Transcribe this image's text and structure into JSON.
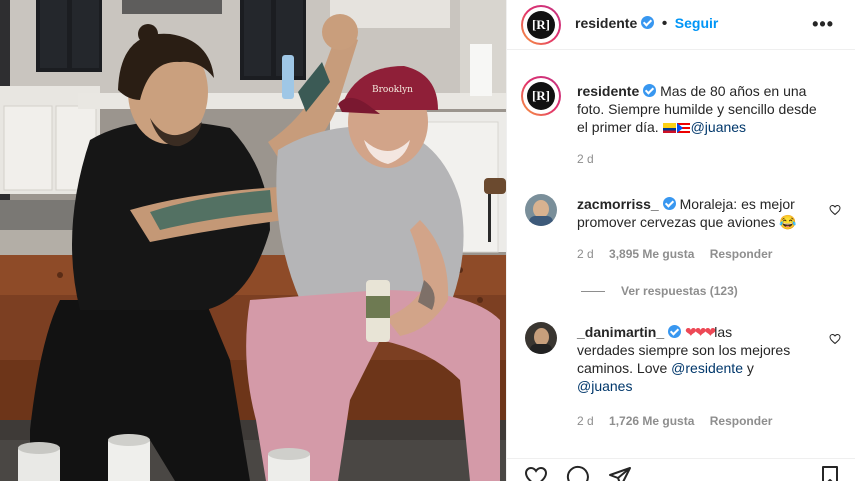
{
  "post": {
    "author": "residente",
    "follow_label": "Seguir",
    "more_label": "•••",
    "caption": {
      "username": "residente",
      "line1": "Mas de 80 años en una",
      "line2": "foto. Siempre humilde y sencillo desde",
      "line3": "el primer día.",
      "mention": "@juanes",
      "flags": [
        "colombia-flag-icon",
        "puerto-rico-flag-icon"
      ]
    },
    "caption_time": "2 d",
    "photo": {
      "cap_text": "Brooklyn"
    }
  },
  "comments": [
    {
      "username": "zacmorriss_",
      "line1": "Moraleja: es mejor",
      "line2": "promover cervezas que aviones",
      "emoji": "😂",
      "time": "2 d",
      "likes": "3,895 Me gusta",
      "reply_label": "Responder",
      "view_replies": "Ver respuestas (123)"
    },
    {
      "username": "_danimartin_",
      "hearts": "❤❤❤",
      "line1_tail": "las",
      "line2": "verdades siempre son los mejores",
      "line3": "caminos. Love",
      "mention1": "@residente",
      "and_word": "y",
      "mention2": "@juanes",
      "time": "2 d",
      "likes": "1,726 Me gusta",
      "reply_label": "Responder"
    }
  ],
  "colors": {
    "accent": "#0095f6",
    "verified": "#3897f0",
    "heart": "#ed4956",
    "muted": "#8e8e8e"
  },
  "icons": [
    "like-icon",
    "comment-icon",
    "share-icon",
    "save-icon"
  ]
}
